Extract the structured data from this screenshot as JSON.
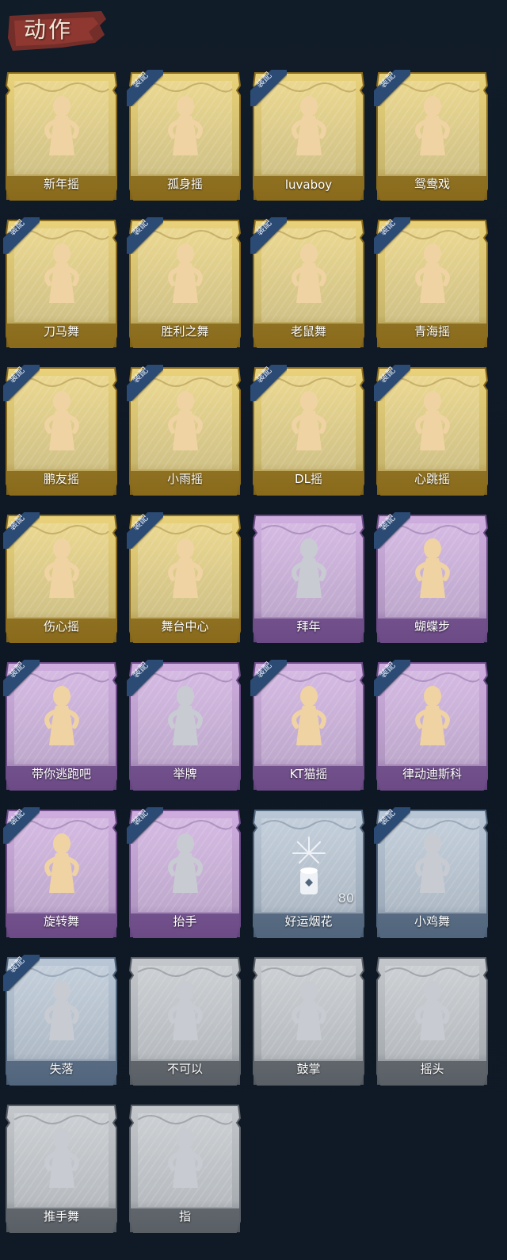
{
  "header": {
    "title": "动作"
  },
  "badge_label": "装配",
  "colors": {
    "gold_light": "#e9d27a",
    "gold_dark": "#8a6a1c",
    "purple_light": "#cfaedf",
    "purple_dark": "#6b4a86",
    "blue_light": "#b9c7d6",
    "blue_dark": "#51657c",
    "gray_light": "#c4c8cc",
    "gray_dark": "#5a5f66",
    "figure_gold": "#f0d3a3",
    "figure_gray": "#c8ccd2"
  },
  "emotes": [
    {
      "name": "新年摇",
      "rarity": "gold",
      "equipped": false,
      "figure_icon": "figure-gold-icon"
    },
    {
      "name": "孤身摇",
      "rarity": "gold",
      "equipped": true,
      "figure_icon": "figure-gold-icon"
    },
    {
      "name": "luvaboy",
      "rarity": "gold",
      "equipped": true,
      "figure_icon": "figure-gold-icon"
    },
    {
      "name": "鸳鸯戏",
      "rarity": "gold",
      "equipped": true,
      "figure_icon": "figure-gold-icon"
    },
    {
      "name": "刀马舞",
      "rarity": "gold",
      "equipped": true,
      "figure_icon": "figure-gold-icon"
    },
    {
      "name": "胜利之舞",
      "rarity": "gold",
      "equipped": true,
      "figure_icon": "figure-gold-icon"
    },
    {
      "name": "老鼠舞",
      "rarity": "gold",
      "equipped": true,
      "figure_icon": "figure-gold-icon"
    },
    {
      "name": "青海摇",
      "rarity": "gold",
      "equipped": true,
      "figure_icon": "figure-gold-icon"
    },
    {
      "name": "鹏友摇",
      "rarity": "gold",
      "equipped": true,
      "figure_icon": "figure-gold-icon"
    },
    {
      "name": "小雨摇",
      "rarity": "gold",
      "equipped": true,
      "figure_icon": "figure-gold-icon"
    },
    {
      "name": "DL摇",
      "rarity": "gold",
      "equipped": true,
      "figure_icon": "figure-gold-icon"
    },
    {
      "name": "心跳摇",
      "rarity": "gold",
      "equipped": true,
      "figure_icon": "figure-gold-icon"
    },
    {
      "name": "伤心摇",
      "rarity": "gold",
      "equipped": true,
      "figure_icon": "figure-gold-icon"
    },
    {
      "name": "舞台中心",
      "rarity": "gold",
      "equipped": true,
      "figure_icon": "figure-gold-icon"
    },
    {
      "name": "拜年",
      "rarity": "purple",
      "equipped": false,
      "figure_icon": "figure-gray-icon"
    },
    {
      "name": "蝴蝶步",
      "rarity": "purple",
      "equipped": true,
      "figure_icon": "figure-gold-icon"
    },
    {
      "name": "带你逃跑吧",
      "rarity": "purple",
      "equipped": true,
      "figure_icon": "figure-gold-icon"
    },
    {
      "name": "举牌",
      "rarity": "purple",
      "equipped": true,
      "figure_icon": "figure-gray-icon"
    },
    {
      "name": "KT猫摇",
      "rarity": "purple",
      "equipped": true,
      "figure_icon": "figure-gold-icon"
    },
    {
      "name": "律动迪斯科",
      "rarity": "purple",
      "equipped": true,
      "figure_icon": "figure-gold-icon"
    },
    {
      "name": "旋转舞",
      "rarity": "purple",
      "equipped": true,
      "figure_icon": "figure-gold-icon"
    },
    {
      "name": "抬手",
      "rarity": "purple",
      "equipped": true,
      "figure_icon": "figure-gray-icon"
    },
    {
      "name": "好运烟花",
      "rarity": "blue",
      "equipped": false,
      "figure_icon": "firework-icon",
      "count": "80"
    },
    {
      "name": "小鸡舞",
      "rarity": "blue",
      "equipped": true,
      "figure_icon": "figure-gray-icon"
    },
    {
      "name": "失落",
      "rarity": "blue",
      "equipped": true,
      "figure_icon": "figure-gray-icon"
    },
    {
      "name": "不可以",
      "rarity": "gray",
      "equipped": false,
      "figure_icon": "figure-gray-icon"
    },
    {
      "name": "鼓掌",
      "rarity": "gray",
      "equipped": false,
      "figure_icon": "figure-gray-icon"
    },
    {
      "name": "摇头",
      "rarity": "gray",
      "equipped": false,
      "figure_icon": "figure-gray-icon"
    },
    {
      "name": "推手舞",
      "rarity": "gray",
      "equipped": false,
      "figure_icon": "figure-gray-icon"
    },
    {
      "name": "指",
      "rarity": "gray",
      "equipped": false,
      "figure_icon": "figure-gray-icon"
    }
  ]
}
